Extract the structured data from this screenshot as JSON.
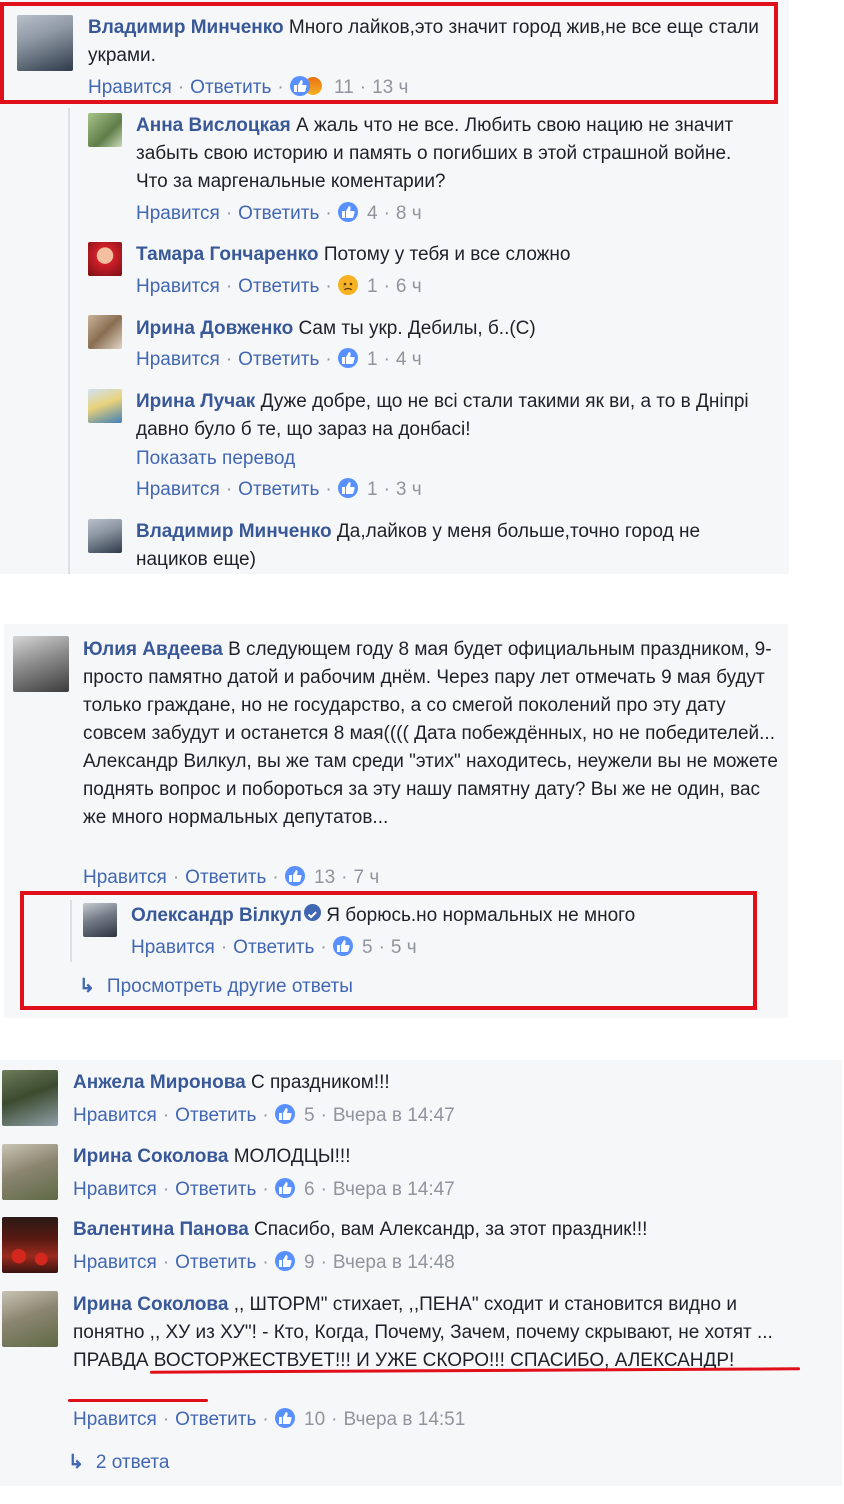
{
  "labels": {
    "like": "Нравится",
    "reply": "Ответить",
    "translate": "Показать перевод",
    "sep": "·"
  },
  "comments": [
    {
      "name": "Владимир Минченко",
      "text": "Много лайков,это значит город жив,не все еще стали украми.",
      "count": "11",
      "time": "13 ч"
    },
    {
      "name": "Анна Вислоцкая",
      "text": "А жаль что не все. Любить свою нацию не значит забыть свою историю и память о погибших в этой страшной войне. Что за маргенальные коментарии?",
      "count": "4",
      "time": "8 ч"
    },
    {
      "name": "Тамара Гончаренко",
      "text": "Потому у тебя и все сложно",
      "count": "1",
      "time": "6 ч"
    },
    {
      "name": "Ирина Довженко",
      "text": "Сам ты укр. Дебилы, б..(С)",
      "count": "1",
      "time": "4 ч"
    },
    {
      "name": "Ирина Лучак",
      "text": "Дуже добре, що не всі стали такими як ви, а то в Дніпрі давно було б те, що зараз на донбасі!",
      "count": "1",
      "time": "3 ч"
    },
    {
      "name": "Владимир Минченко",
      "text": "Да,лайков у меня больше,точно город не нациков еще)"
    },
    {
      "name": "Юлия Авдеева",
      "text": "В следующем году 8 мая будет официальным праздником, 9-просто памятно датой и рабочим днём. Через пару лет отмечать 9 мая будут только граждане, но не государство, а со смегой поколений про эту дату совсем забудут и останется 8 мая(((( Дата побеждённых, но не победителей... Александр Вилкул, вы же там среди \"этих\" находитесь, неужели вы не можете поднять вопрос и побороться за эту нашу памятну дату? Вы же не один, вас же много нормальных депутатов...",
      "count": "13",
      "time": "7 ч"
    },
    {
      "name": "Олександр Вілкул",
      "text": "Я борюсь.но нормальных не много",
      "count": "5",
      "time": "5 ч"
    },
    {
      "name": "Анжела Миронова",
      "text": "С праздником!!!",
      "count": "5",
      "time": "Вчера в 14:47"
    },
    {
      "name": "Ирина Соколова",
      "text": "МОЛОДЦЫ!!!",
      "count": "6",
      "time": "Вчера в 14:47"
    },
    {
      "name": "Валентина Панова",
      "text": "Спасибо, вам Александр, за этот праздник!!!",
      "count": "9",
      "time": "Вчера в 14:48"
    },
    {
      "name": "Ирина Соколова",
      "text_a": ",, ШТОРМ\" стихает, ,,ПЕНА\" сходит и становится видно и понятно ,, ХУ из ХУ\"! - Кто, Когда, Почему, Зачем, почему скрывают, не хотят ... ",
      "text_b": "ПРАВДА ВОСТОРЖЕСТВУЕТ!!! И УЖЕ СКОРО!!! СПАСИБО, АЛЕКСАНДР!",
      "count": "10",
      "time": "Вчера в 14:51"
    }
  ],
  "more_replies": {
    "view_other": "Просмотреть другие ответы",
    "two_replies": "2 ответа"
  },
  "colors": {
    "name": "#385898",
    "link": "#4267b2",
    "meta": "#90949c",
    "highlight": "#e0101b",
    "like_badge": "#5890ff"
  }
}
